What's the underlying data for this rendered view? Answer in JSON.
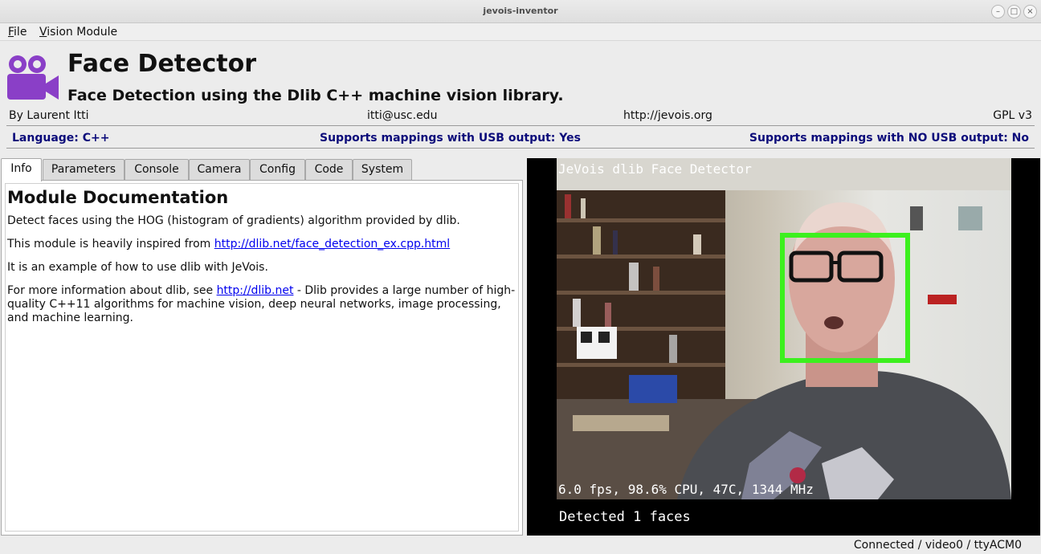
{
  "window": {
    "title": "jevois-inventor"
  },
  "menu": {
    "file_rest": "ile",
    "file_key": "F",
    "vision_key": "V",
    "vision_rest": "ision Module"
  },
  "module": {
    "icon": "video-camera-icon",
    "title": "Face Detector",
    "subtitle": "Face Detection using the Dlib C++ machine vision library.",
    "author": "By Laurent Itti",
    "email": "itti@usc.edu",
    "website": "http://jevois.org",
    "license": "GPL v3",
    "language": "Language: C++",
    "usb_yes": "Supports mappings with USB output: Yes",
    "usb_no": "Supports mappings with NO USB output: No"
  },
  "tabs": [
    "Info",
    "Parameters",
    "Console",
    "Camera",
    "Config",
    "Code",
    "System"
  ],
  "doc": {
    "heading": "Module Documentation",
    "p1": "Detect faces using the HOG (histogram of gradients) algorithm provided by dlib.",
    "p2_pre": "This module is heavily inspired from ",
    "p2_link": "http://dlib.net/face_detection_ex.cpp.html",
    "p3": "It is an example of how to use dlib with JeVois.",
    "p4_pre": "For more information about dlib, see ",
    "p4_link": "http://dlib.net",
    "p4_post": " - Dlib provides a large number of high-quality C++11 algorithms for machine vision, deep neural networks, image processing, and machine learning."
  },
  "video": {
    "overlay_title": "JeVois dlib Face Detector",
    "overlay_stats": "6.0 fps, 98.6% CPU, 47C, 1344 MHz",
    "overlay_detect": "Detected 1 faces",
    "box_color": "#3cf01e"
  },
  "status": {
    "connection": "Connected / video0 / ttyACM0"
  },
  "colors": {
    "accent_purple": "#8a3fc7",
    "support_text": "#0b0b7a",
    "link": "#0000ee"
  }
}
